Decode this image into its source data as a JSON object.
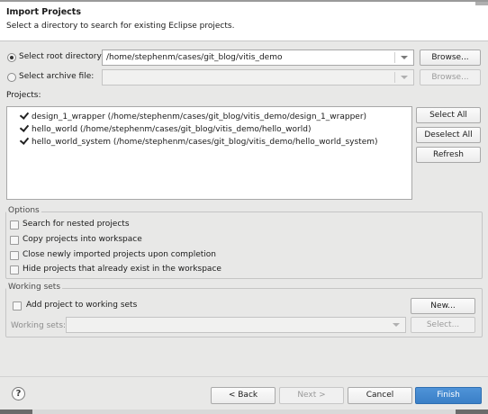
{
  "header": {
    "title": "Import Projects",
    "description": "Select a directory to search for existing Eclipse projects."
  },
  "source": {
    "root_directory_label": "Select root directory:",
    "root_directory_value": "/home/stephenm/cases/git_blog/vitis_demo",
    "archive_file_label": "Select archive file:",
    "archive_file_value": "",
    "browse_label": "Browse...",
    "browse_archive_label": "Browse..."
  },
  "projects": {
    "label": "Projects:",
    "items": [
      {
        "label": "design_1_wrapper (/home/stephenm/cases/git_blog/vitis_demo/design_1_wrapper)",
        "checked": true
      },
      {
        "label": "hello_world (/home/stephenm/cases/git_blog/vitis_demo/hello_world)",
        "checked": true
      },
      {
        "label": "hello_world_system (/home/stephenm/cases/git_blog/vitis_demo/hello_world_system)",
        "checked": true
      }
    ],
    "select_all": "Select All",
    "deselect_all": "Deselect All",
    "refresh": "Refresh"
  },
  "options": {
    "title": "Options",
    "items": [
      {
        "label": "Search for nested projects",
        "checked": false
      },
      {
        "label": "Copy projects into workspace",
        "checked": false
      },
      {
        "label": "Close newly imported projects upon completion",
        "checked": false
      },
      {
        "label": "Hide projects that already exist in the workspace",
        "checked": false
      }
    ]
  },
  "working_sets": {
    "title": "Working sets",
    "add_label": "Add project to working sets",
    "add_checked": false,
    "new_button": "New...",
    "sets_label": "Working sets:",
    "sets_value": "",
    "select_button": "Select..."
  },
  "footer": {
    "help": "?",
    "back": "< Back",
    "next": "Next >",
    "cancel": "Cancel",
    "finish": "Finish"
  }
}
